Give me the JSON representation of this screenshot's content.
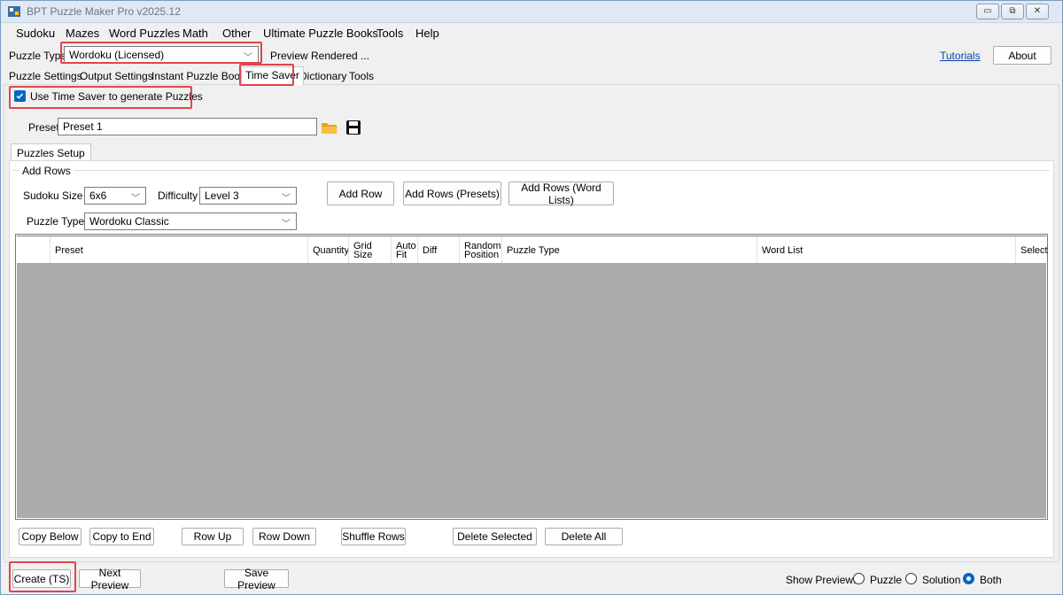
{
  "window": {
    "title": "BPT Puzzle Maker Pro v2025.12",
    "minimize_icon": "minimize-icon",
    "maximize_icon": "restore-icon",
    "close_icon": "close-icon"
  },
  "menu": [
    "Sudoku",
    "Mazes",
    "Word Puzzles",
    "Math",
    "Other",
    "Ultimate Puzzle Books",
    "Tools",
    "Help"
  ],
  "toolbar": {
    "puzzle_type_label": "Puzzle Type",
    "puzzle_type_value": "Wordoku (Licensed)",
    "preview_status": "Preview Rendered ...",
    "tutorials_link": "Tutorials",
    "about_label": "About"
  },
  "tabs": [
    "Puzzle Settings",
    "Output Settings",
    "Instant Puzzle Books",
    "Time Saver",
    "Dictionary",
    "Tools"
  ],
  "time_saver": {
    "use_checkbox_label": "Use Time Saver to generate Puzzles",
    "use_checked": true,
    "preset_label": "Preset",
    "preset_value": "Preset 1",
    "inner_tab": "Puzzles Setup",
    "add_rows_group": "Add Rows",
    "sudoku_size_label": "Sudoku Size",
    "sudoku_size_value": "6x6",
    "difficulty_label": "Difficulty",
    "difficulty_value": "Level 3",
    "puzzle_type_label": "Puzzle Type",
    "puzzle_type_value": "Wordoku Classic",
    "add_row": "Add Row",
    "add_rows_presets": "Add Rows (Presets)",
    "add_rows_word_lists": "Add Rows (Word Lists)"
  },
  "grid": {
    "columns": [
      {
        "label": ""
      },
      {
        "label": "Preset"
      },
      {
        "label": "Quantity"
      },
      {
        "label": "Grid Size"
      },
      {
        "label": "Auto Fit"
      },
      {
        "label": "Diff"
      },
      {
        "label": "Random Position"
      },
      {
        "label": "Puzzle Type"
      },
      {
        "label": "Word List"
      },
      {
        "label": "Select"
      }
    ],
    "rows": []
  },
  "row_actions": {
    "copy_below": "Copy Below",
    "copy_to_end": "Copy to End",
    "row_up": "Row Up",
    "row_down": "Row Down",
    "shuffle_rows": "Shuffle Rows",
    "delete_selected": "Delete Selected",
    "delete_all": "Delete All"
  },
  "footer": {
    "create": "Create (TS)",
    "next_preview": "Next Preview",
    "save_preview": "Save Preview",
    "show_preview_label": "Show Preview:",
    "options": [
      "Puzzle",
      "Solution",
      "Both"
    ],
    "selected": "Both"
  },
  "colors": {
    "highlight": "#e0454b",
    "accent": "#0067c0",
    "grid_bg": "#ababab",
    "link": "#0645ad"
  }
}
